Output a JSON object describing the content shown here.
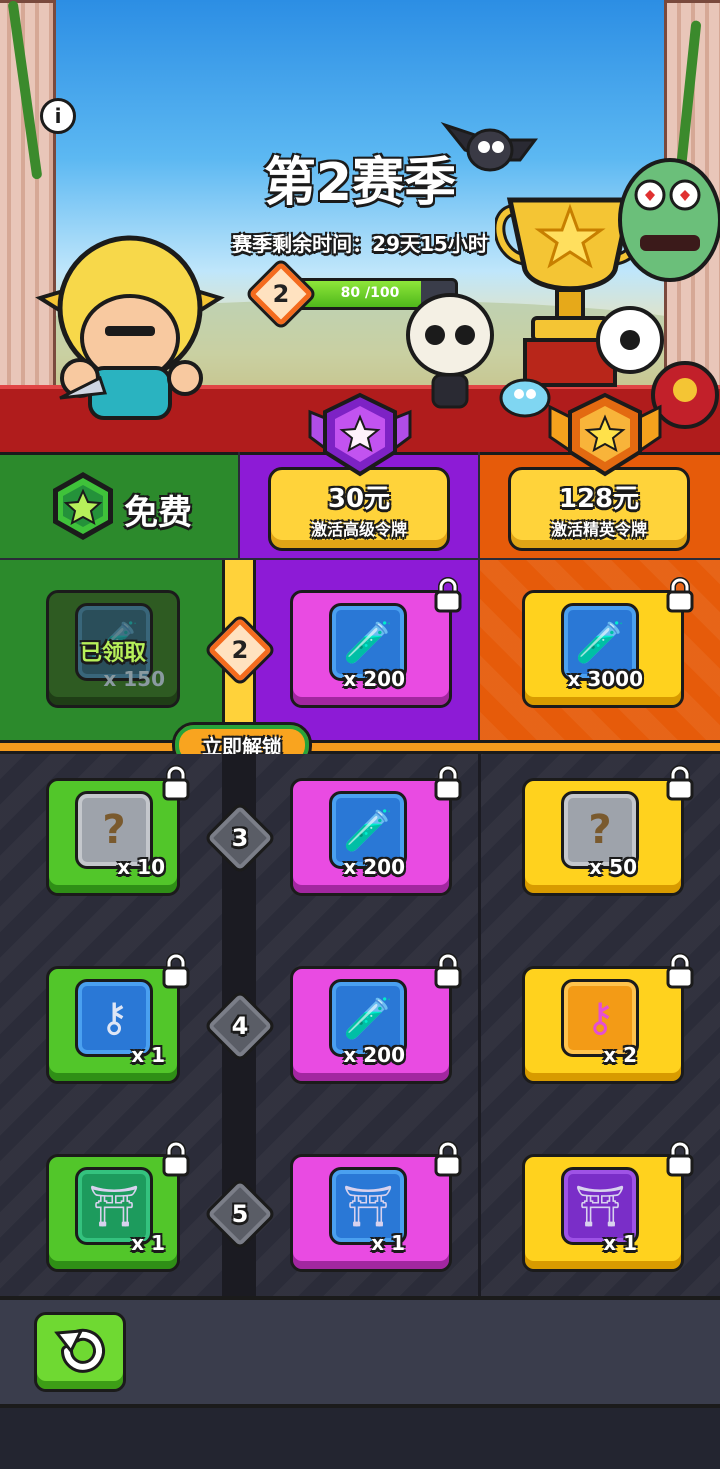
{
  "season": {
    "title": "第2赛季",
    "time_label": "赛季剩余时间：29天15小时",
    "level": "2",
    "progress_text": "80 /100",
    "progress_value": 0.8
  },
  "tiers": {
    "free": {
      "label": "免费"
    },
    "premium": {
      "price": "30元",
      "subtitle": "激活高级令牌"
    },
    "elite": {
      "price": "128元",
      "subtitle": "激活精英令牌"
    }
  },
  "unlock_label": "立即解锁",
  "rows": [
    {
      "level": "2",
      "free": {
        "claimed_label": "已领取",
        "qty": "x 150",
        "icon": "potion-icon"
      },
      "premium": {
        "qty": "x 200",
        "icon": "potion-icon"
      },
      "elite": {
        "qty": "x 3000",
        "icon": "potion-icon"
      }
    },
    {
      "level": "3",
      "free": {
        "qty": "x 10",
        "icon": "mystery-scroll-icon"
      },
      "premium": {
        "qty": "x 200",
        "icon": "potion-icon"
      },
      "elite": {
        "qty": "x 50",
        "icon": "mystery-scroll-icon"
      }
    },
    {
      "level": "4",
      "free": {
        "qty": "x 1",
        "icon": "key-icon"
      },
      "premium": {
        "qty": "x 200",
        "icon": "potion-icon"
      },
      "elite": {
        "qty": "x 2",
        "icon": "gold-key-icon"
      }
    },
    {
      "level": "5",
      "free": {
        "qty": "x 1",
        "icon": "gate-icon"
      },
      "premium": {
        "qty": "x 1",
        "icon": "gate-icon"
      },
      "elite": {
        "qty": "x 1",
        "icon": "gate-icon"
      }
    }
  ],
  "colors": {
    "free": "#2c8a2c",
    "premium": "#8d1bd6",
    "elite": "#e65b0a",
    "accent": "#f49a1d"
  }
}
